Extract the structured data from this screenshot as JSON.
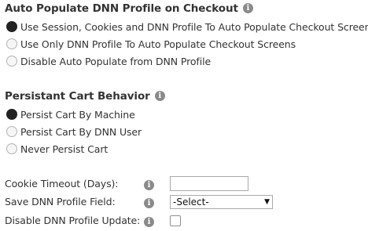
{
  "auto_populate": {
    "title": "Auto Populate DNN Profile on Checkout",
    "info_icon": "info-icon",
    "options": [
      {
        "label": "Use Session, Cookies and DNN Profile To Auto Populate Checkout Screens",
        "checked": true
      },
      {
        "label": "Use Only DNN Profile To Auto Populate Checkout Screens",
        "checked": false
      },
      {
        "label": "Disable Auto Populate from DNN Profile",
        "checked": false
      }
    ]
  },
  "persistent_cart": {
    "title": "Persistant Cart Behavior",
    "info_icon": "info-icon",
    "options": [
      {
        "label": "Persist Cart By Machine",
        "checked": true
      },
      {
        "label": "Persist Cart By DNN User",
        "checked": false
      },
      {
        "label": "Never Persist Cart",
        "checked": false
      }
    ]
  },
  "fields": {
    "cookie_timeout": {
      "label": "Cookie Timeout (Days):",
      "value": ""
    },
    "save_profile_field": {
      "label": "Save DNN Profile Field:",
      "selected": "-Select-"
    },
    "disable_profile_update": {
      "label": "Disable DNN Profile Update:",
      "checked": false
    }
  },
  "icons": {
    "info_glyph": "i"
  },
  "colors": {
    "info_icon_bg": "#8a8a8a",
    "text": "#333333"
  }
}
